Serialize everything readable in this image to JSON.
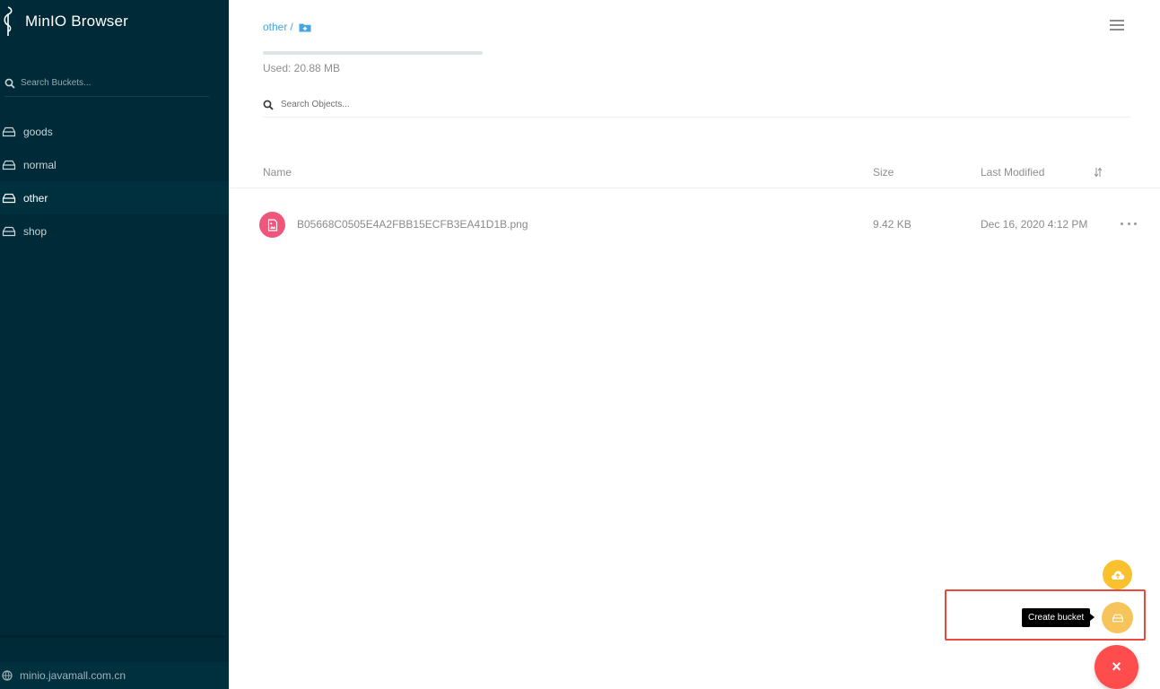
{
  "sidebar": {
    "title": "MinIO Browser",
    "search_placeholder": "Search Buckets...",
    "buckets": [
      {
        "label": "goods"
      },
      {
        "label": "normal"
      },
      {
        "label": "other"
      },
      {
        "label": "shop"
      }
    ],
    "active_bucket": "other",
    "host": "minio.javamall.com.cn"
  },
  "main": {
    "breadcrumb": {
      "bucket": "other",
      "separator": "/"
    },
    "usage": {
      "label": "Used: 20.88 MB"
    },
    "search_placeholder": "Search Objects...",
    "columns": {
      "name": "Name",
      "size": "Size",
      "modified": "Last Modified"
    },
    "files": [
      {
        "name": "B05668C0505E4A2FBB15ECFB3EA41D1B.png",
        "size": "9.42 KB",
        "modified": "Dec 16, 2020 4:12 PM"
      }
    ]
  },
  "fab": {
    "tooltip": "Create bucket",
    "close_glyph": "×"
  },
  "colors": {
    "sidebar_bg": "#002a37",
    "accent_link": "#46a5e0",
    "file_icon": "#f0567b",
    "fab_upload": "#f9c12e",
    "fab_bucket": "#f7c45b",
    "fab_close": "#ff4d4d",
    "highlight_border": "#e84a3b"
  }
}
